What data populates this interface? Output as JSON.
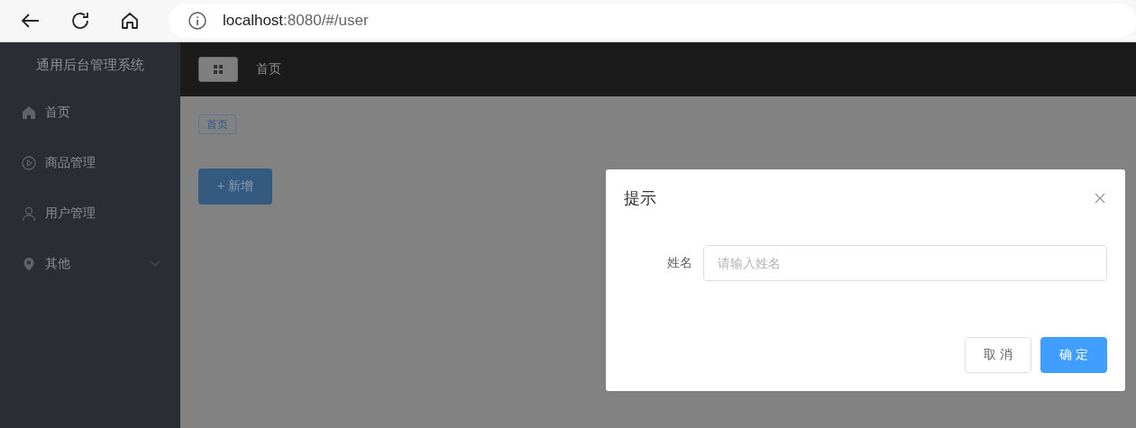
{
  "browser": {
    "url_host": "localhost",
    "url_rest": ":8080/#/user"
  },
  "sidebar": {
    "title": "通用后台管理系统",
    "items": [
      {
        "label": "首页"
      },
      {
        "label": "商品管理"
      },
      {
        "label": "用户管理"
      },
      {
        "label": "其他",
        "expanded": false
      }
    ]
  },
  "header": {
    "title": "首页"
  },
  "tags": [
    {
      "label": "首页"
    }
  ],
  "add_button": "+ 新增",
  "dialog": {
    "title": "提示",
    "field_label": "姓名",
    "placeholder": "请输入姓名",
    "buttons": [
      {
        "label": "取 消",
        "kind": "secondary"
      },
      {
        "label": "确 定",
        "kind": "primary"
      }
    ]
  }
}
